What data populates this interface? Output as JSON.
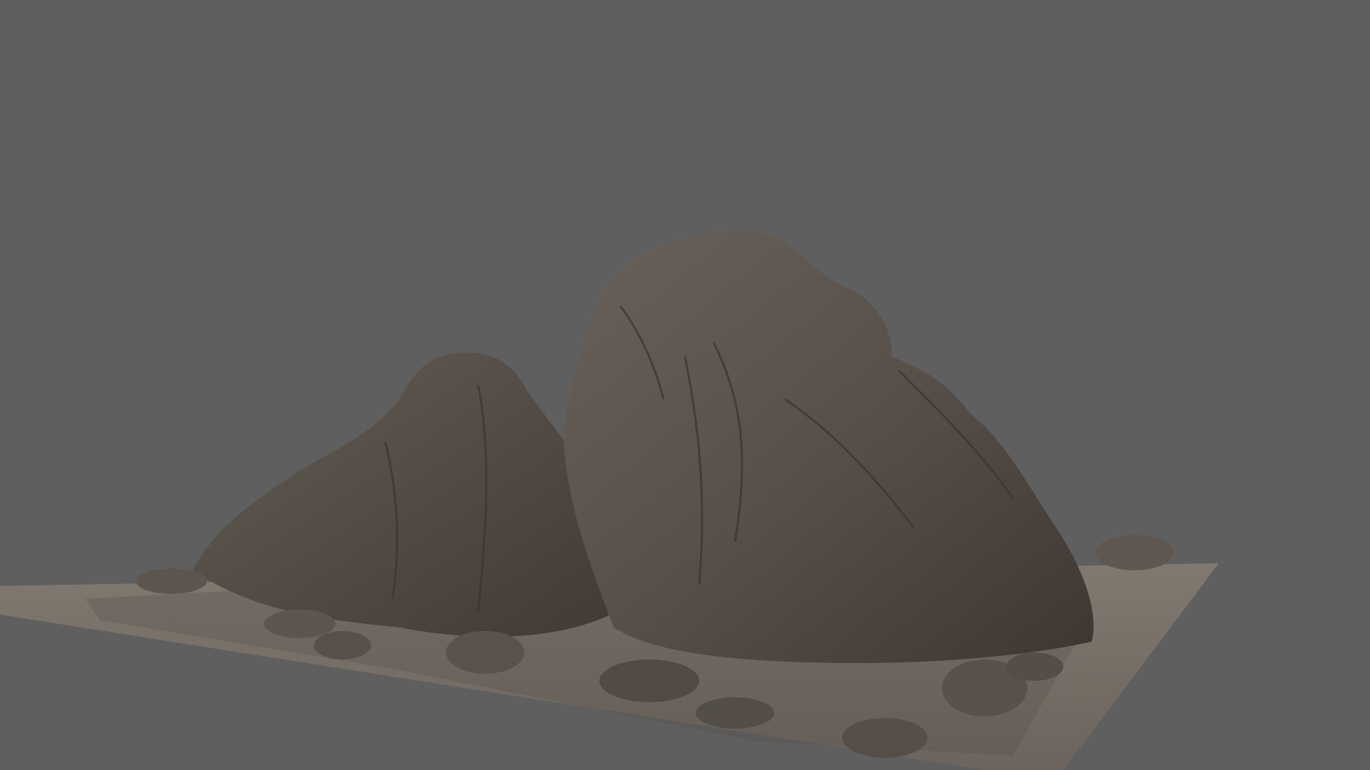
{
  "viewport": {
    "background_color": "#5f5f5f",
    "content": "3d-rock-formation-render"
  },
  "scene": {
    "objects": [
      {
        "name": "ground-plane",
        "color": "#7b7268"
      },
      {
        "name": "rock-formation-large",
        "color": "#5e5650"
      },
      {
        "name": "rock-formation-left",
        "color": "#5a534c"
      },
      {
        "name": "boulders",
        "color": "#544c45"
      }
    ]
  }
}
